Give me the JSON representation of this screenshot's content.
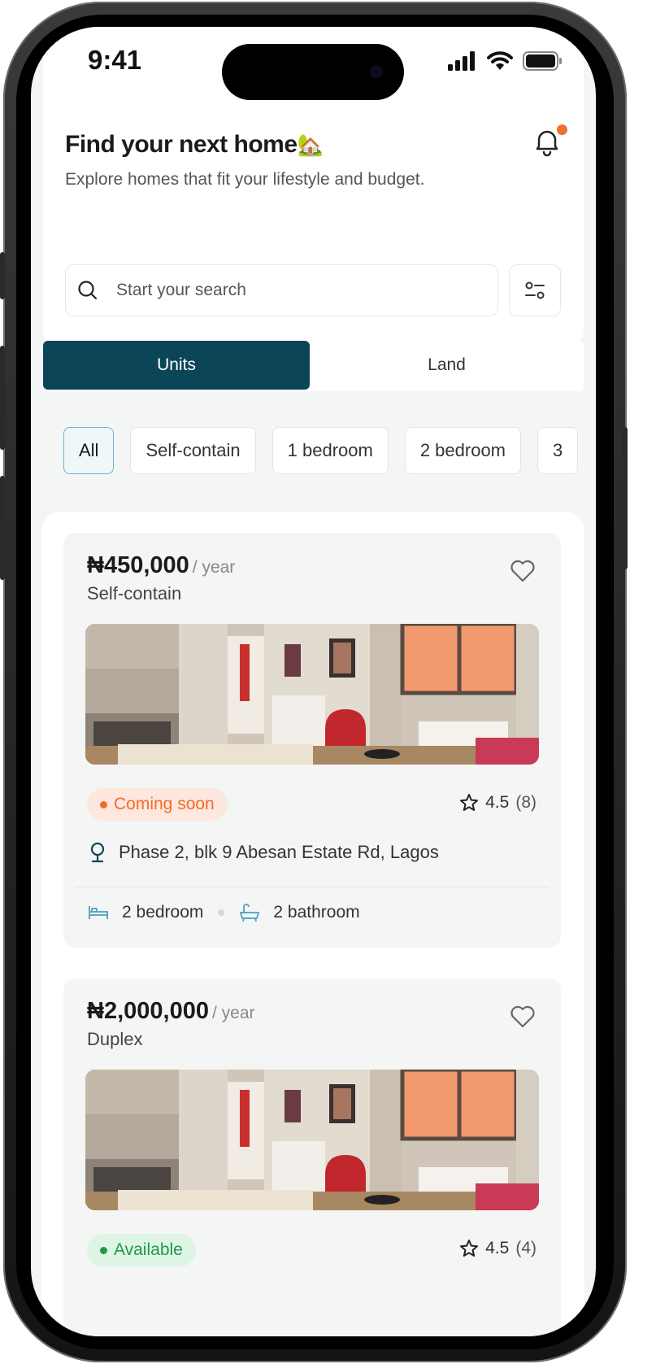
{
  "status_bar": {
    "time": "9:41"
  },
  "header": {
    "title": "Find your next home",
    "title_emoji": "🏡",
    "subtitle": "Explore homes that fit your lifestyle and budget."
  },
  "search": {
    "placeholder": "Start your search"
  },
  "tabs": [
    {
      "label": "Units",
      "active": true
    },
    {
      "label": "Land",
      "active": false
    }
  ],
  "chips": [
    {
      "label": "All",
      "active": true
    },
    {
      "label": "Self-contain",
      "active": false
    },
    {
      "label": "1 bedroom",
      "active": false
    },
    {
      "label": "2 bedroom",
      "active": false
    },
    {
      "label": "3",
      "active": false
    }
  ],
  "listings": [
    {
      "price": "₦450,000",
      "price_unit": "/ year",
      "type": "Self-contain",
      "status": "Coming soon",
      "status_color": "#f26b2a",
      "status_bg": "#fde7de",
      "rating": "4.5",
      "rating_count": "(8)",
      "address": "Phase 2, blk 9 Abesan Estate Rd, Lagos",
      "bedrooms": "2 bedroom",
      "bathrooms": "2 bathroom"
    },
    {
      "price": "₦2,000,000",
      "price_unit": "/ year",
      "type": "Duplex",
      "status": "Available",
      "status_color": "#1f9a4c",
      "status_bg": "#def4e4",
      "rating": "4.5",
      "rating_count": "(4)"
    }
  ],
  "colors": {
    "primary": "#0d4558",
    "accent_icon": "#5aa8c2",
    "notification_dot": "#f07030"
  }
}
